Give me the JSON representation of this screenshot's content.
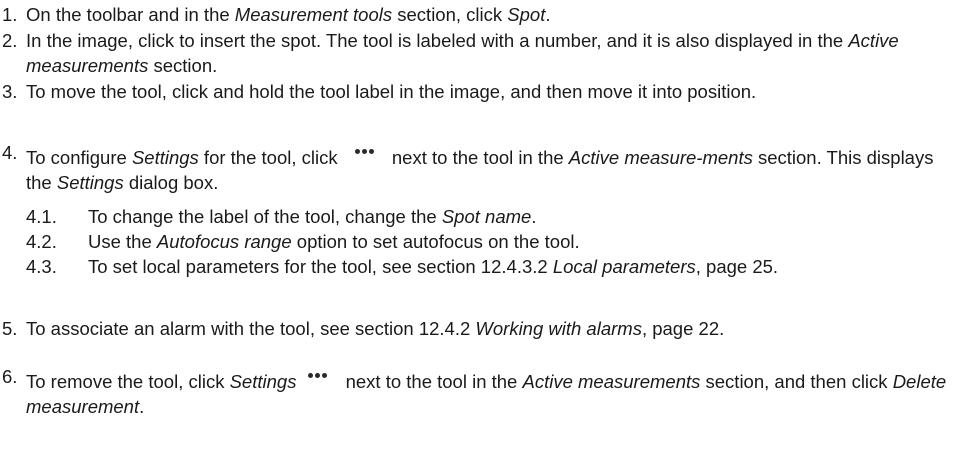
{
  "steps": [
    {
      "num": "1.",
      "t1": "On the toolbar and in the ",
      "i1": "Measurement tools",
      "t2": " section, click ",
      "i2": "Spot",
      "t3": "."
    },
    {
      "num": "2.",
      "t1": "In the image, click to insert the spot. The tool is labeled with a number, and it is also displayed in the ",
      "i1": "Active measurements",
      "t2": " section."
    },
    {
      "num": "3.",
      "t1": "To move the tool, click and hold the tool label in the image, and then move it into position."
    },
    {
      "num": "4.",
      "t1": "To configure ",
      "i1": "Settings",
      "t2": " for the tool, click ",
      "t3": " next to the tool in the ",
      "i2": "Active measure-ments",
      "t4": " section. This displays the ",
      "i3": "Settings",
      "t5": " dialog box.",
      "icon": "more-options-icon"
    },
    {
      "num": "5.",
      "t1": "To associate an alarm with the tool, see section 12.4.2 ",
      "i1": "Working with alarms",
      "t2": ", page 22."
    },
    {
      "num": "6.",
      "t1": "To remove the tool, click ",
      "i1": "Settings",
      "t2": " next to the tool in the ",
      "i2": "Active measurements",
      "t3": " section, and then click ",
      "i3": "Delete measurement",
      "t4": ".",
      "icon": "more-options-icon"
    }
  ],
  "substeps": [
    {
      "num": "4.1.",
      "t1": "To change the label of the tool, change the ",
      "i1": "Spot name",
      "t2": "."
    },
    {
      "num": "4.2.",
      "t1": "Use the ",
      "i1": "Autofocus range",
      "t2": " option to set autofocus on the tool."
    },
    {
      "num": "4.3.",
      "t1": "To set local parameters for the tool, see section 12.4.3.2 ",
      "i1": "Local parameters",
      "t2": ", page 25."
    }
  ]
}
